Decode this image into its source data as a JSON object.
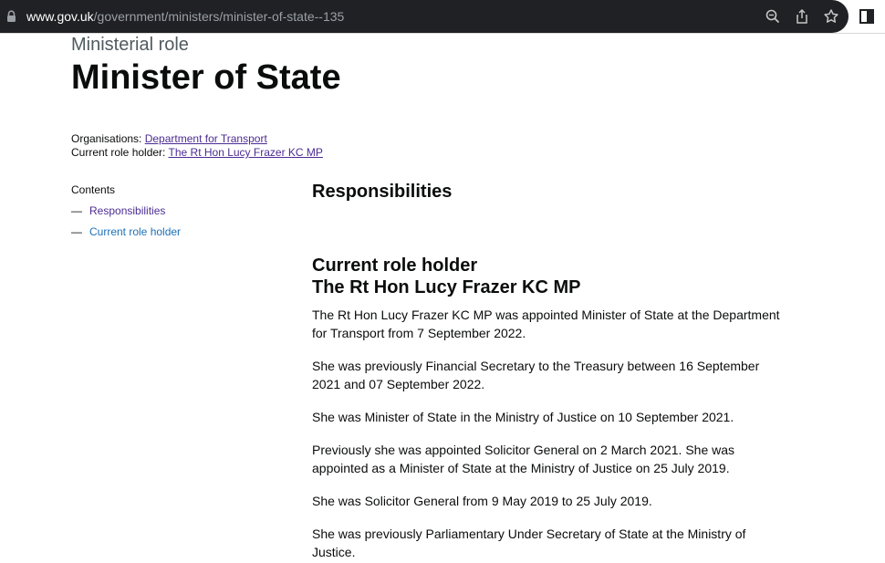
{
  "browser": {
    "url_domain": "www.gov.uk",
    "url_path": "/government/ministers/minister-of-state--135"
  },
  "header": {
    "caption": "Ministerial role",
    "title": "Minister of State"
  },
  "meta": {
    "organisations_label": "Organisations:",
    "organisation_link": "Department for Transport",
    "role_holder_label": "Current role holder:",
    "role_holder_link": "The Rt Hon Lucy Frazer KC MP"
  },
  "contents": {
    "title": "Contents",
    "dash": "—",
    "items": [
      {
        "label": "Responsibilities"
      },
      {
        "label": "Current role holder"
      }
    ]
  },
  "main": {
    "responsibilities_heading": "Responsibilities",
    "current_holder_heading": "Current role holder",
    "holder_name": "The Rt Hon Lucy Frazer KC MP",
    "paragraphs": [
      "The Rt Hon Lucy Frazer KC MP was appointed Minister of State at the Department for Transport from 7 September 2022.",
      "She was previously Financial Secretary to the Treasury between 16 September 2021 and 07 September 2022.",
      "She was Minister of State in the Ministry of Justice on 10 September 2021.",
      "Previously she was appointed Solicitor General on 2 March 2021. She was appointed as a Minister of State at the Ministry of Justice on 25 July 2019.",
      "She was Solicitor General from 9 May 2019 to 25 July 2019.",
      "She was previously Parliamentary Under Secretary of State at the Ministry of Justice."
    ]
  }
}
